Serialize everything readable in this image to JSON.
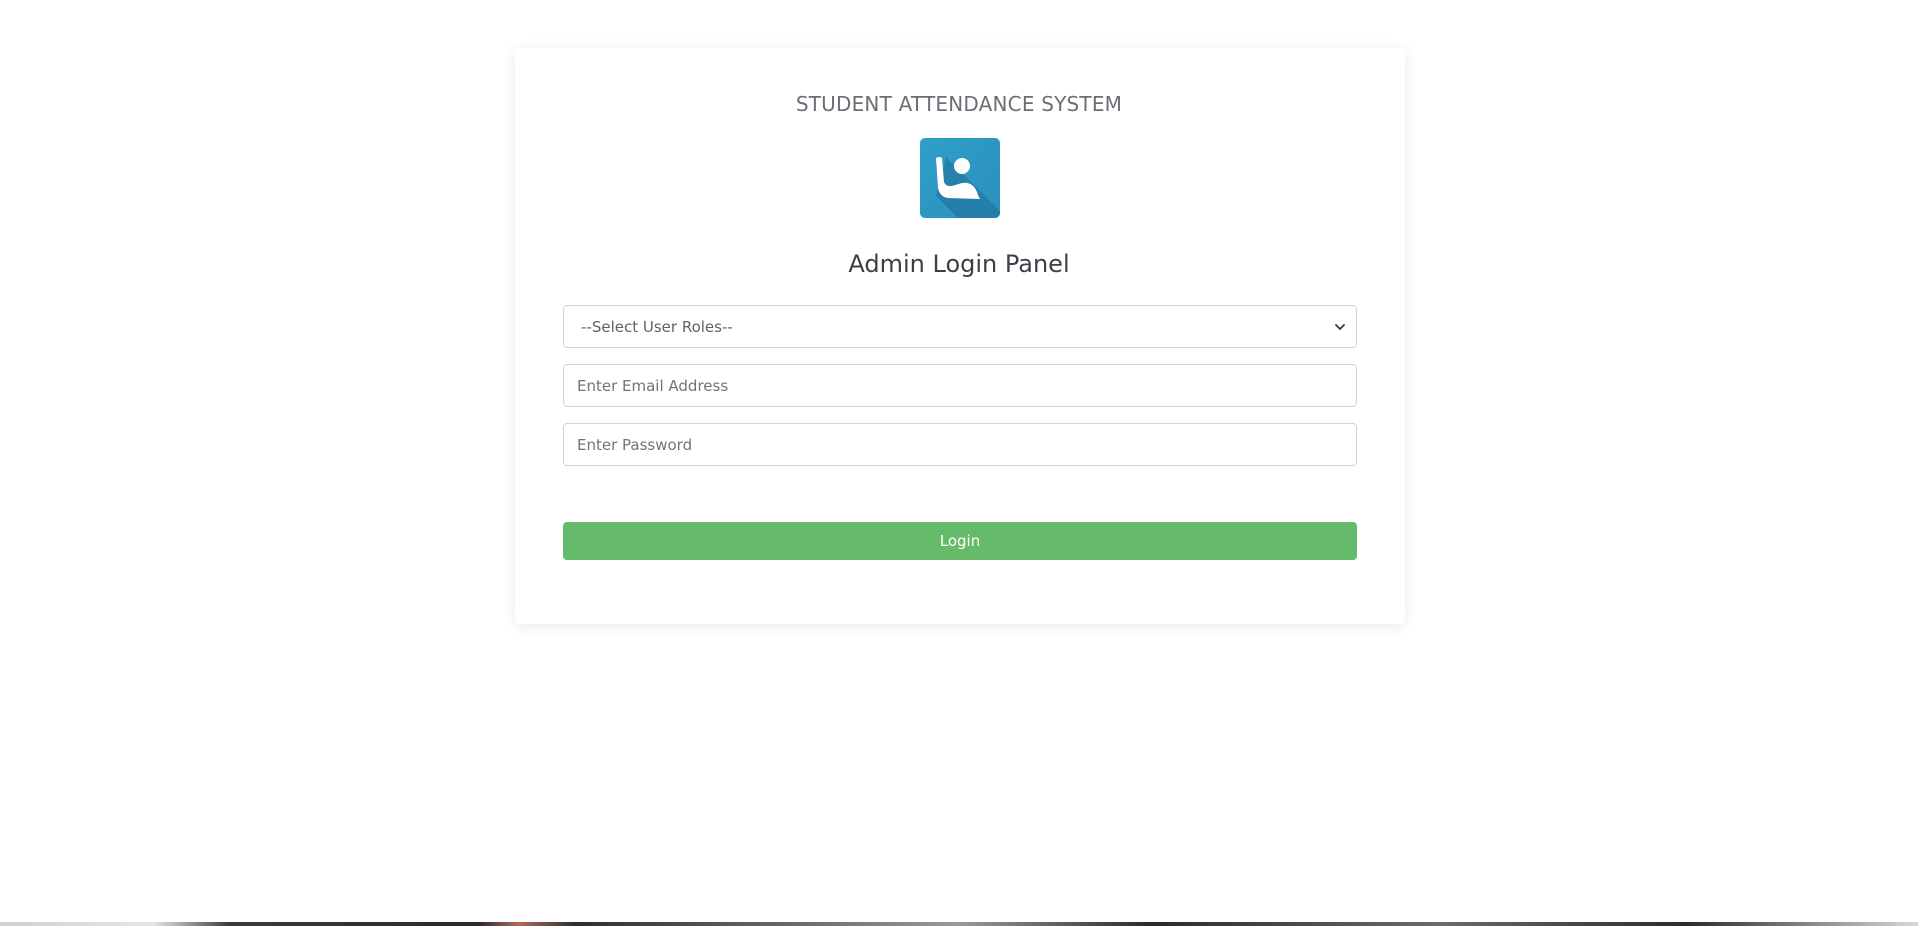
{
  "app": {
    "system_title": "STUDENT ATTENDANCE SYSTEM",
    "panel_title": "Admin Login Panel"
  },
  "logo": {
    "icon": "student-raising-hand-icon",
    "background_color": "#2f9ac3"
  },
  "form": {
    "role_select": {
      "selected": "--Select User Roles--"
    },
    "email": {
      "value": "",
      "placeholder": "Enter Email Address"
    },
    "password": {
      "value": "",
      "placeholder": "Enter Password"
    },
    "login_label": "Login"
  },
  "colors": {
    "login_button": "#66bb6a",
    "title_text": "#6b6f75"
  }
}
